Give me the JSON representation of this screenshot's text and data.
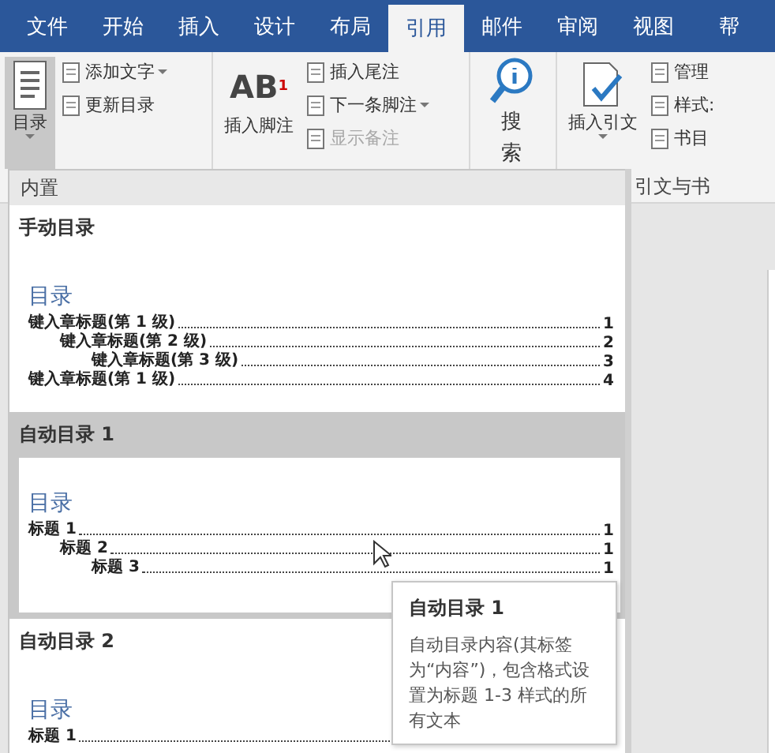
{
  "tabs": [
    {
      "label": "文件",
      "selected": false
    },
    {
      "label": "开始",
      "selected": false
    },
    {
      "label": "插入",
      "selected": false
    },
    {
      "label": "设计",
      "selected": false
    },
    {
      "label": "布局",
      "selected": false
    },
    {
      "label": "引用",
      "selected": true
    },
    {
      "label": "邮件",
      "selected": false
    },
    {
      "label": "审阅",
      "selected": false
    },
    {
      "label": "视图",
      "selected": false
    },
    {
      "label": "帮",
      "selected": false
    }
  ],
  "ribbon": {
    "groups": [
      {
        "controls": [
          {
            "kind": "large",
            "label": "目录",
            "dropdown": true,
            "pressed": true
          },
          {
            "kind": "stack",
            "items": [
              {
                "label": "添加文字",
                "dropdown": true,
                "disabled": false
              },
              {
                "label": "更新目录",
                "dropdown": false,
                "disabled": false
              }
            ]
          }
        ]
      },
      {
        "controls": [
          {
            "kind": "large",
            "label": "插入脚注",
            "glyph": "AB$^{1}$",
            "dropdown": false,
            "pressed": false
          },
          {
            "kind": "stack",
            "items": [
              {
                "label": "插入尾注",
                "dropdown": false,
                "disabled": false
              },
              {
                "label": "下一条脚注",
                "dropdown": true,
                "disabled": false
              },
              {
                "label": "显示备注",
                "dropdown": false,
                "disabled": true
              }
            ]
          }
        ]
      },
      {
        "controls": [
          {
            "kind": "vertical",
            "label": "搜索"
          }
        ]
      },
      {
        "label": "引文与书",
        "controls": [
          {
            "kind": "large",
            "label": "插入引文",
            "dropdown": true,
            "pressed": false
          },
          {
            "kind": "stack",
            "items": [
              {
                "label": "管理",
                "dropdown": false,
                "disabled": false
              },
              {
                "label": "样式:",
                "dropdown": false,
                "disabled": false
              },
              {
                "label": "书目",
                "dropdown": false,
                "disabled": false
              }
            ]
          }
        ]
      }
    ]
  },
  "toc_menu": {
    "header": "内置",
    "entries": [
      {
        "title": "手动目录",
        "selected": false,
        "preview": {
          "heading": "目录",
          "rows": [
            {
              "text": "键入章标题(第 1 级)",
              "page": "1",
              "children": [
                {
                  "text": "键入章标题(第 2 级)",
                  "page": "2",
                  "children": [
                    {
                      "text": "键入章标题(第 3 级)",
                      "page": "3"
                    }
                  ]
                }
              ]
            },
            {
              "text": "键入章标题(第 1 级)",
              "page": "4"
            }
          ]
        }
      },
      {
        "title": "自动目录 1",
        "selected": true,
        "preview": {
          "heading": "目录",
          "rows": [
            {
              "text": "标题 1",
              "page": "1",
              "children": [
                {
                  "text": "标题 2",
                  "page": "1",
                  "children": [
                    {
                      "text": "标题 3",
                      "page": "1"
                    }
                  ]
                }
              ]
            }
          ]
        }
      },
      {
        "title": "自动目录 2",
        "selected": false,
        "preview": {
          "heading": "目录",
          "rows": [
            {
              "text": "标题 1",
              "page": ""
            }
          ]
        }
      }
    ]
  },
  "tooltip": {
    "title": "自动目录 1",
    "text": "自动目录内容(其标签为“内容”)，包含格式设置为标题 1-3 样式的所有文本"
  }
}
